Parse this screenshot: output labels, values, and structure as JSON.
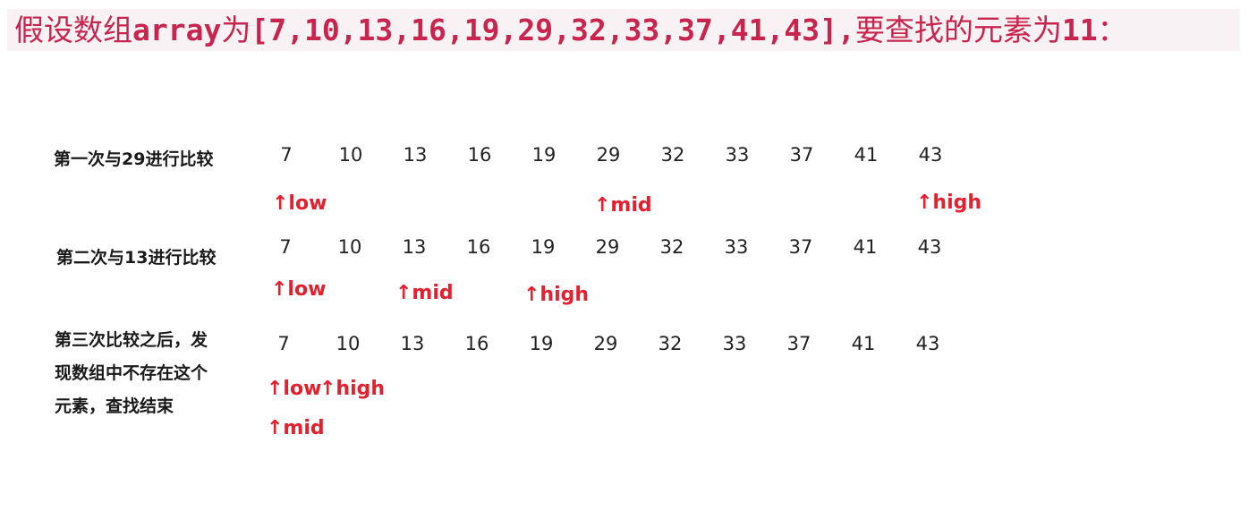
{
  "heading": {
    "prefix": "假设数组",
    "array_word": "array",
    "middle": "为",
    "array_literal": "[7,10,13,16,19,29,32,33,37,41,43],",
    "target_prefix": "要查找的元素为",
    "target": "11",
    "suffix": "："
  },
  "array": [
    "7",
    "10",
    "13",
    "16",
    "19",
    "29",
    "32",
    "33",
    "37",
    "41",
    "43"
  ],
  "steps": [
    {
      "label_lines": [
        "第一次与29进行比较"
      ],
      "pointers": [
        {
          "text": "↑low",
          "index": 0
        },
        {
          "text": "↑mid",
          "index": 5
        },
        {
          "text": "↑high",
          "index": 10
        }
      ]
    },
    {
      "label_lines": [
        "第二次与13进行比较"
      ],
      "pointers": [
        {
          "text": "↑low",
          "index": 0
        },
        {
          "text": "↑mid",
          "index": 2
        },
        {
          "text": "↑high",
          "index": 4
        }
      ]
    },
    {
      "label_lines": [
        "第三次比较之后，发",
        "现数组中不存在这个",
        "元素，查找结束"
      ],
      "pointers": [
        {
          "text": "↑low",
          "index": 0
        },
        {
          "text": "↑high",
          "index": 1
        },
        {
          "text": "↑mid",
          "index": 0
        }
      ]
    }
  ],
  "colors": {
    "heading_text": "#c7254e",
    "heading_background": "#f9f2f4",
    "pointer": "#e5202e",
    "numbers": "#222222",
    "labels": "#1a1a1a"
  }
}
